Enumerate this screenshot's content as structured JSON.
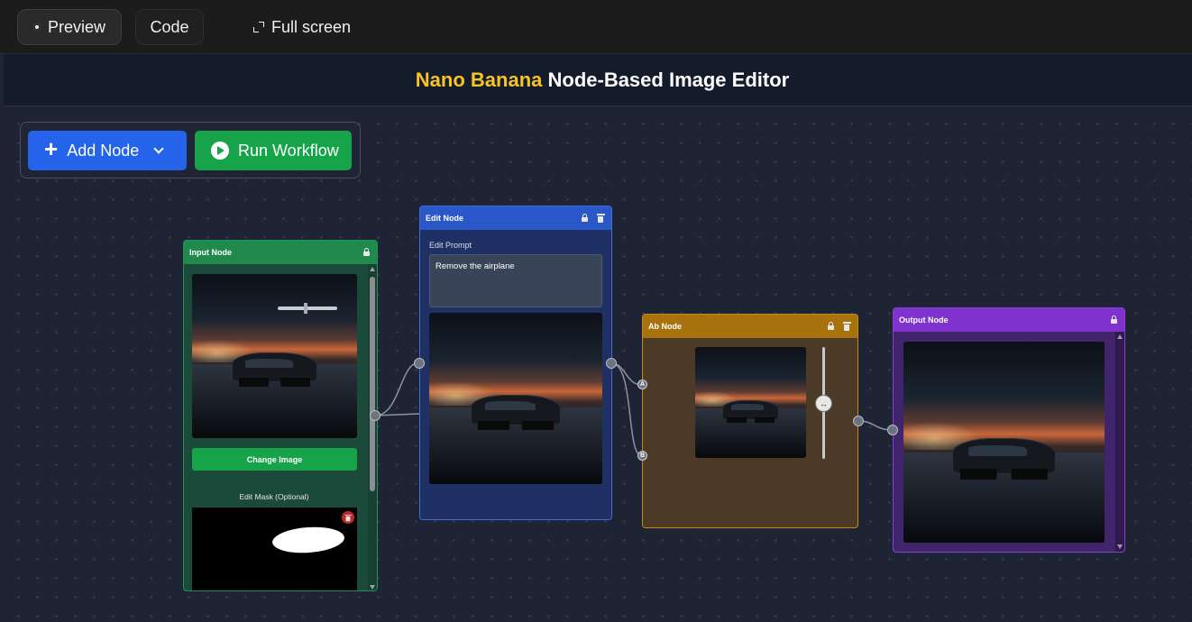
{
  "topbar": {
    "preview_label": "Preview",
    "code_label": "Code",
    "fullscreen_label": "Full screen"
  },
  "header": {
    "title_accent": "Nano Banana",
    "title_rest": " Node-Based Image Editor"
  },
  "toolbar": {
    "add_node_label": "Add Node",
    "run_workflow_label": "Run Workflow"
  },
  "input_node": {
    "title": "Input Node",
    "change_image_label": "Change Image",
    "mask_label": "Edit Mask (Optional)"
  },
  "edit_node": {
    "title": "Edit Node",
    "prompt_label": "Edit Prompt",
    "prompt_value": "Remove the airplane"
  },
  "ab_node": {
    "title": "Ab Node",
    "port_a": "A",
    "port_b": "B",
    "slider_glyph": "↔"
  },
  "output_node": {
    "title": "Output Node"
  },
  "colors": {
    "accent": "#f7c325",
    "add_button": "#2563eb",
    "run_button": "#16a34a",
    "input_node": "#1f8a4c",
    "edit_node": "#2a58c8",
    "ab_node": "#a8720f",
    "output_node": "#7f33cc"
  },
  "icons": [
    "preview-dot-icon",
    "fullscreen-icon",
    "plus-icon",
    "chevron-down-icon",
    "play-icon",
    "lock-icon",
    "trash-icon"
  ]
}
